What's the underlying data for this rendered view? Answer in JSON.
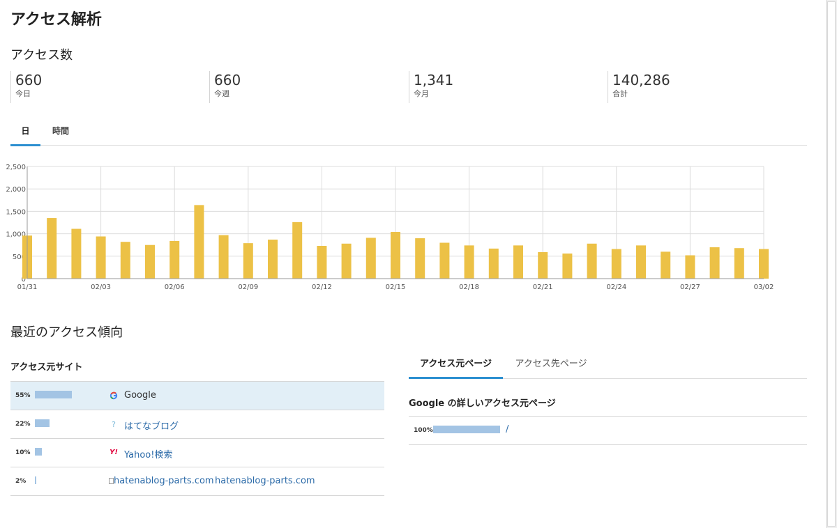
{
  "page": {
    "title": "アクセス解析"
  },
  "access_count": {
    "title": "アクセス数",
    "stats": [
      {
        "value": "660",
        "label": "今日"
      },
      {
        "value": "660",
        "label": "今週"
      },
      {
        "value": "1,341",
        "label": "今月"
      },
      {
        "value": "140,286",
        "label": "合計"
      }
    ]
  },
  "chart_tabs": [
    {
      "label": "日",
      "active": true
    },
    {
      "label": "時間",
      "active": false
    }
  ],
  "chart_data": {
    "type": "bar",
    "categories": [
      "01/31",
      "02/01",
      "02/02",
      "02/03",
      "02/04",
      "02/05",
      "02/06",
      "02/07",
      "02/08",
      "02/09",
      "02/10",
      "02/11",
      "02/12",
      "02/13",
      "02/14",
      "02/15",
      "02/16",
      "02/17",
      "02/18",
      "02/19",
      "02/20",
      "02/21",
      "02/22",
      "02/23",
      "02/24",
      "02/25",
      "02/26",
      "02/27",
      "02/28",
      "03/01",
      "03/02"
    ],
    "x_tick_labels": [
      "01/31",
      "02/03",
      "02/06",
      "02/09",
      "02/12",
      "02/15",
      "02/18",
      "02/21",
      "02/24",
      "02/27",
      "03/02"
    ],
    "values": [
      960,
      1350,
      1110,
      940,
      820,
      750,
      840,
      1640,
      970,
      790,
      870,
      1260,
      730,
      780,
      910,
      1040,
      900,
      800,
      740,
      670,
      740,
      590,
      560,
      780,
      660,
      740,
      600,
      520,
      700,
      680,
      660
    ],
    "ylim": [
      0,
      2500
    ],
    "y_ticks": [
      "0",
      "500",
      "1,000",
      "1,500",
      "2,000",
      "2,500"
    ],
    "y_tick_values": [
      0,
      500,
      1000,
      1500,
      2000,
      2500
    ],
    "grid": true,
    "colors": {
      "bar": "#ecc146",
      "grid": "#dcdcdc",
      "axis": "#9a9a9a",
      "tick_text": "#555555"
    }
  },
  "recent": {
    "title": "最近のアクセス傾向",
    "sources_title": "アクセス元サイト",
    "sources": [
      {
        "percent_label": "55%",
        "percent": 55,
        "icon": "google-g-icon",
        "icon_text": "G",
        "name": "Google",
        "selected": true,
        "img_alt": ""
      },
      {
        "percent_label": "22%",
        "percent": 22,
        "icon": "hatena-icon",
        "icon_text": "?",
        "name": "はてなブログ",
        "selected": false,
        "img_alt": ""
      },
      {
        "percent_label": "10%",
        "percent": 10,
        "icon": "yahoo-icon",
        "icon_text": "Y!",
        "name": "Yahoo!検索",
        "selected": false,
        "img_alt": ""
      },
      {
        "percent_label": "2%",
        "percent": 2,
        "icon": "broken-image-icon",
        "icon_text": "",
        "name": "hatenablog-parts.com",
        "selected": false,
        "img_alt": "hatenablog-parts.com"
      }
    ],
    "page_tabs": [
      {
        "label": "アクセス元ページ",
        "active": true
      },
      {
        "label": "アクセス先ページ",
        "active": false
      }
    ],
    "detail_title": "Google の詳しいアクセス元ページ",
    "detail_rows": [
      {
        "percent_label": "100%",
        "percent": 100,
        "path": "/"
      }
    ]
  }
}
